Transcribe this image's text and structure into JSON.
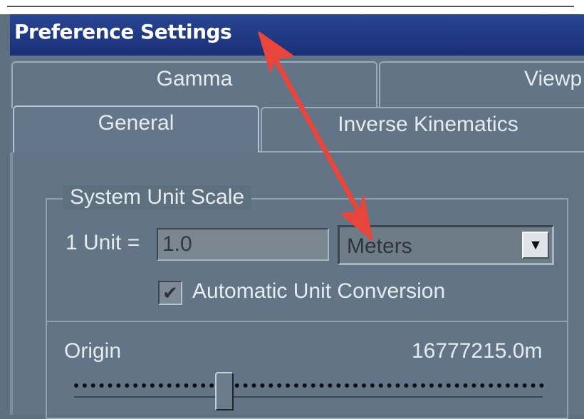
{
  "window": {
    "title": "Preference Settings"
  },
  "tabs": {
    "row1": [
      {
        "label": "Gamma"
      },
      {
        "label": "Viewp"
      }
    ],
    "row2": [
      {
        "label": "General",
        "active": true
      },
      {
        "label": "Inverse Kinematics"
      }
    ]
  },
  "system_unit_scale": {
    "group_label": "System Unit Scale",
    "unit_label": "1 Unit =",
    "unit_value": "1.0",
    "unit_type": "Meters",
    "auto_conversion_label": "Automatic Unit Conversion",
    "auto_conversion_checked": true
  },
  "origin": {
    "label": "Origin",
    "value": "16777215.0m",
    "slider_fraction": 0.32
  },
  "icons": {
    "dropdown": "chevron-down-icon",
    "checkmark": "check-icon"
  },
  "colors": {
    "title_bar": "#1f3a8a",
    "panel": "#5e6f7f",
    "annotation_arrow": "#e8453c"
  }
}
